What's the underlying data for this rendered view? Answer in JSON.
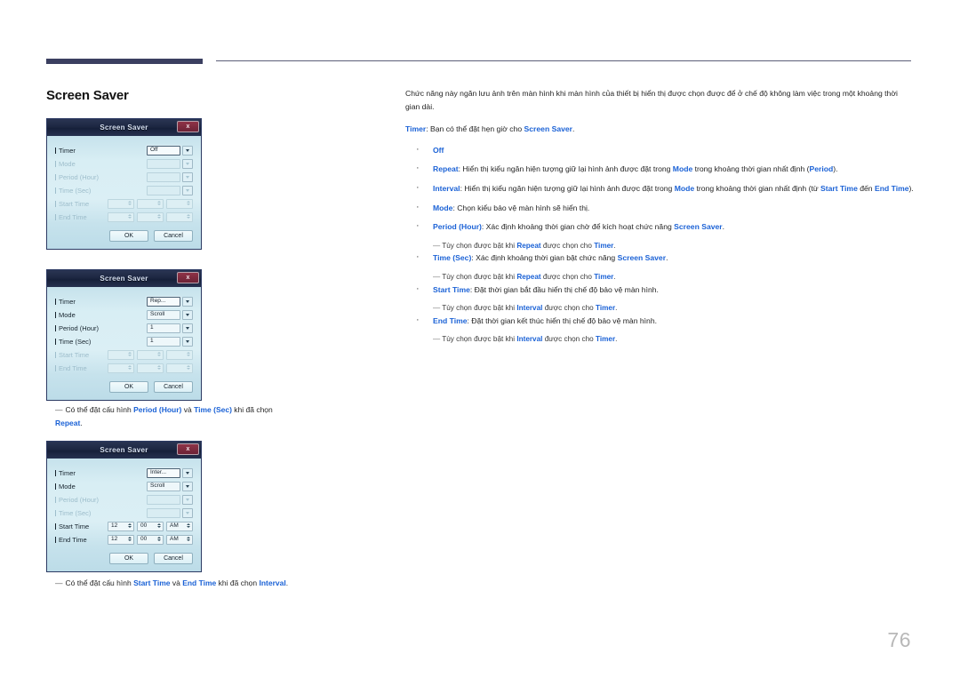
{
  "document": {
    "page_number": "76",
    "section_title": "Screen Saver",
    "accent_color": "#1b62d6",
    "rule_color": "#3b3f60"
  },
  "dialogs": [
    {
      "name": "screen-saver-off",
      "title": "Screen Saver",
      "close_label": "x",
      "rows": [
        {
          "label": "Timer",
          "disabled": false,
          "control": "combo",
          "value": "Off",
          "focused": true
        },
        {
          "label": "Mode",
          "disabled": true,
          "control": "combo",
          "value": ""
        },
        {
          "label": "Period (Hour)",
          "disabled": true,
          "control": "combo",
          "value": ""
        },
        {
          "label": "Time (Sec)",
          "disabled": true,
          "control": "combo",
          "value": ""
        },
        {
          "label": "Start Time",
          "disabled": true,
          "control": "spinners",
          "values": [
            "",
            "",
            ""
          ]
        },
        {
          "label": "End Time",
          "disabled": true,
          "control": "spinners",
          "values": [
            "",
            "",
            ""
          ]
        }
      ],
      "ok_label": "OK",
      "cancel_label": "Cancel"
    },
    {
      "name": "screen-saver-repeat",
      "title": "Screen Saver",
      "close_label": "x",
      "rows": [
        {
          "label": "Timer",
          "disabled": false,
          "control": "combo",
          "value": "Rep...",
          "focused": true
        },
        {
          "label": "Mode",
          "disabled": false,
          "control": "combo",
          "value": "Scroll"
        },
        {
          "label": "Period (Hour)",
          "disabled": false,
          "control": "combo",
          "value": "1"
        },
        {
          "label": "Time (Sec)",
          "disabled": false,
          "control": "combo",
          "value": "1"
        },
        {
          "label": "Start Time",
          "disabled": true,
          "control": "spinners",
          "values": [
            "",
            "",
            ""
          ]
        },
        {
          "label": "End Time",
          "disabled": true,
          "control": "spinners",
          "values": [
            "",
            "",
            ""
          ]
        }
      ],
      "ok_label": "OK",
      "cancel_label": "Cancel"
    },
    {
      "name": "screen-saver-interval",
      "title": "Screen Saver",
      "close_label": "x",
      "rows": [
        {
          "label": "Timer",
          "disabled": false,
          "control": "combo",
          "value": "Inter...",
          "focused": true
        },
        {
          "label": "Mode",
          "disabled": false,
          "control": "combo",
          "value": "Scroll"
        },
        {
          "label": "Period (Hour)",
          "disabled": true,
          "control": "combo",
          "value": ""
        },
        {
          "label": "Time (Sec)",
          "disabled": true,
          "control": "combo",
          "value": ""
        },
        {
          "label": "Start Time",
          "disabled": false,
          "control": "spinners",
          "values": [
            "12",
            "00",
            "AM"
          ]
        },
        {
          "label": "End Time",
          "disabled": false,
          "control": "spinners",
          "values": [
            "12",
            "00",
            "AM"
          ]
        }
      ],
      "ok_label": "OK",
      "cancel_label": "Cancel"
    }
  ],
  "captions": {
    "repeat": {
      "dash": "—",
      "text_1": "Có thể đặt cấu hình ",
      "b1": "Period (Hour)",
      "text_2": " và ",
      "b2": "Time (Sec)",
      "text_3": " khi đã chọn ",
      "b3": "Repeat",
      "text_4": "."
    },
    "interval": {
      "dash": "—",
      "text_1": "Có thể đặt cấu hình ",
      "b1": "Start Time",
      "text_2": " và ",
      "b2": "End Time",
      "text_3": " khi đã chọn ",
      "b3": "Interval",
      "text_4": "."
    }
  },
  "body": {
    "intro": "Chức năng này ngăn lưu ảnh trên màn hình khi màn hình của thiết bị hiển thị được chọn được để ở chế độ không làm việc trong một khoảng thời gian dài.",
    "timer_line": {
      "term": "Timer",
      "text_1": ": Bạn có thể đặt hẹn giờ cho ",
      "term_2": "Screen Saver",
      "text_2": "."
    },
    "items": [
      {
        "term": "Off",
        "text_1": "",
        "term_2": "",
        "text_2": "",
        "term_3": "",
        "text_3": "",
        "note": null
      },
      {
        "term": "Repeat",
        "text_1": ": Hiển thị kiểu ngăn hiện tượng giữ lại hình ảnh được đặt trong ",
        "term_2": "Mode",
        "text_2": " trong khoảng thời gian nhất định (",
        "term_3": "Period",
        "text_3": ").",
        "note": null
      },
      {
        "term": "Interval",
        "text_1": ": Hiển thị kiểu ngăn hiện tượng giữ lại hình ảnh được đặt trong ",
        "term_2": "Mode",
        "text_2": " trong khoảng thời gian nhất định (từ ",
        "term_3": "Start Time",
        "text_3": " đến ",
        "term_4": "End Time",
        "text_4": ").",
        "note": null
      },
      {
        "term": "Mode",
        "text_1": ": Chọn kiểu bảo vệ màn hình sẽ hiển thị.",
        "term_2": "",
        "text_2": "",
        "note": null
      },
      {
        "term": "Period (Hour)",
        "text_1": ": Xác định khoảng thời gian chờ để kích hoạt chức năng ",
        "term_2": "Screen Saver",
        "text_2": ".",
        "note": {
          "dash": "—",
          "text_1": "Tùy chọn được bật khi ",
          "term_1": "Repeat",
          "text_2": " được chọn cho ",
          "term_2": "Timer",
          "text_3": "."
        }
      },
      {
        "term": "Time (Sec)",
        "text_1": ": Xác định khoảng thời gian bật chức năng ",
        "term_2": "Screen Saver",
        "text_2": ".",
        "note": {
          "dash": "—",
          "text_1": "Tùy chọn được bật khi ",
          "term_1": "Repeat",
          "text_2": " được chọn cho ",
          "term_2": "Timer",
          "text_3": "."
        }
      },
      {
        "term": "Start Time",
        "text_1": ": Đặt thời gian bắt đầu hiển thị chế độ bảo vệ màn hình.",
        "term_2": "",
        "text_2": "",
        "note": {
          "dash": "—",
          "text_1": "Tùy chọn được bật khi ",
          "term_1": "Interval",
          "text_2": " được chọn cho ",
          "term_2": "Timer",
          "text_3": "."
        }
      },
      {
        "term": "End Time",
        "text_1": ": Đặt thời gian kết thúc hiển thị chế độ bảo vệ màn hình.",
        "term_2": "",
        "text_2": "",
        "note": {
          "dash": "—",
          "text_1": "Tùy chọn được bật khi ",
          "term_1": "Interval",
          "text_2": " được chọn cho ",
          "term_2": "Timer",
          "text_3": "."
        }
      }
    ]
  }
}
